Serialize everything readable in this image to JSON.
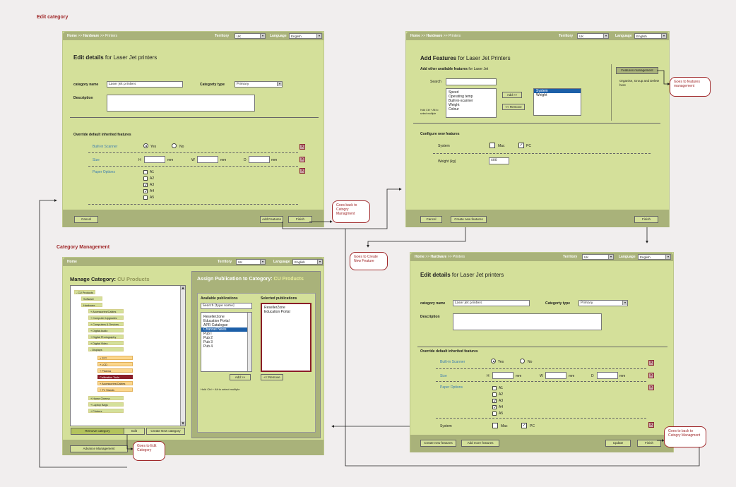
{
  "sections": {
    "edit_category": "Edit category",
    "category_management": "Category Management"
  },
  "common": {
    "territory_label": "Territory",
    "territory_value": "UK",
    "language_label": "Language",
    "language_value": "English",
    "home": "Home",
    "sep": " >> ",
    "hardware": "Hardware",
    "printers": "Printers"
  },
  "edit1": {
    "title_bold": "Edit details",
    "title_rest": " for Laser Jet printers",
    "cat_name_label": "category name",
    "cat_name_value": "Laser Jet printers",
    "cat_type_label": "Categorty type",
    "cat_type_value": "Primary",
    "desc_label": "Description",
    "override_label": "Override default inherited features",
    "builtin_label": "Built-in Scanner",
    "yes": "Yes",
    "no": "No",
    "size_label": "Size",
    "h": "H",
    "w": "W",
    "d": "D",
    "mm": "mm",
    "paper_label": "Paper Options",
    "paper": [
      "A1",
      "A2",
      "A3",
      "A4",
      "A5"
    ],
    "cancel": "Cancel",
    "add_features": "Add Features",
    "finish": "Finish"
  },
  "addfeat": {
    "title_bold": "Add Features",
    "title_rest": " for Laser Jet Printers",
    "sub_bold": "Add other available features",
    "sub_rest": " for Laser Jet",
    "search_label": "Search",
    "available": [
      "Speed",
      "Operating temp",
      "Built-in-scanner",
      "Weight",
      "Colour"
    ],
    "hold_hint": "Hold Ctrl + Alt to select multiple",
    "add_btn": "Add >>",
    "remove_btn": "<< Remove",
    "selected": [
      "System",
      "Weight"
    ],
    "fm_btn": "Features management",
    "fm_hint": "Organise, Group and Delete here",
    "configure": "Configure new features",
    "system": "System",
    "mac": "Mac",
    "pc": "PC",
    "weight_label": "Weight (kg)",
    "weight_value": "400",
    "cancel": "Cancel",
    "create_new": "Create new features",
    "finish": "Finish"
  },
  "catmgmt": {
    "manage_bold": "Manage Category:",
    "manage_prod": " CU Products",
    "assign_bold": "Assign Publication to Catogory:",
    "assign_prod": " CU Products",
    "tree": [
      {
        "t": "- CU Products",
        "lv": 0
      },
      {
        "t": "Software",
        "lv": 1
      },
      {
        "t": "Hardware",
        "lv": 1
      },
      {
        "t": "+ Accessories/Cables",
        "lv": 2
      },
      {
        "t": "+ Computer Upgrades",
        "lv": 2
      },
      {
        "t": "+ Computers & Devices",
        "lv": 2
      },
      {
        "t": "+ Digital Audio",
        "lv": 2
      },
      {
        "t": "+ Digital Photography",
        "lv": 2
      },
      {
        "t": "+ Digital Video",
        "lv": 2
      },
      {
        "t": "- Displays",
        "lv": 2
      },
      {
        "t": "+ TFT",
        "lv": 3
      },
      {
        "t": "+ LCD",
        "lv": 3
      },
      {
        "t": "+ Plasma",
        "lv": 3
      },
      {
        "t": "Calibration Tools",
        "lv": 3
      },
      {
        "t": "+ Accessories/Cables",
        "lv": 3
      },
      {
        "t": "+ TV Stands",
        "lv": 3
      },
      {
        "t": "+ Home Cinema",
        "lv": 2
      },
      {
        "t": "+ Laptop Bags",
        "lv": 2
      },
      {
        "t": "+ Printers",
        "lv": 2
      }
    ],
    "remove_cat": "Remove category",
    "edit": "Edit",
    "create_cat": "Create New category",
    "advance": "Advance Management",
    "avail_pub": "Available publications",
    "search_ph": "Search [type name]",
    "pubs": [
      "ResellerZone",
      "Education Portal",
      "APR Catalogue",
      "Channel News",
      "Pub I",
      "Pub 2",
      "Pub 3",
      "Pub 4"
    ],
    "sel_pub": "Selected publications",
    "sel_pubs": [
      "ResellerZone",
      "Education Portal"
    ],
    "add": "Add >>",
    "remove": "<< Remove",
    "hold_hint": "Hold Ctrl + Alt to select multiple"
  },
  "edit2": {
    "title_bold": "Edit details",
    "title_rest": " for Laser Jet printers",
    "cat_name_label": "category name",
    "cat_name_value": "Laser Jet printers",
    "cat_type_label": "Categorty type",
    "cat_type_value": "Primary",
    "desc_label": "Description",
    "override_label": "Override default inherited features",
    "builtin_label": "Built-in Scanner",
    "yes": "Yes",
    "no": "No",
    "size_label": "Size",
    "h": "H",
    "w": "W",
    "d": "D",
    "mm": "mm",
    "paper_label": "Paper Options",
    "paper": [
      "A1",
      "A2",
      "A3",
      "A4",
      "A5"
    ],
    "system": "System",
    "mac": "Mac",
    "pc": "PC",
    "create_new": "Create new features",
    "add_more": "Add more features",
    "update": "Update",
    "finish": "Finish"
  },
  "notes": {
    "back1": "Goes back to Catogry Managment",
    "features_mgmt": "Goes to features management",
    "create_feature": "Goes to Create New Feature",
    "edit_cat": "Goes to Edit Catogory",
    "back2": "Goes to back to Catogry Managment"
  }
}
